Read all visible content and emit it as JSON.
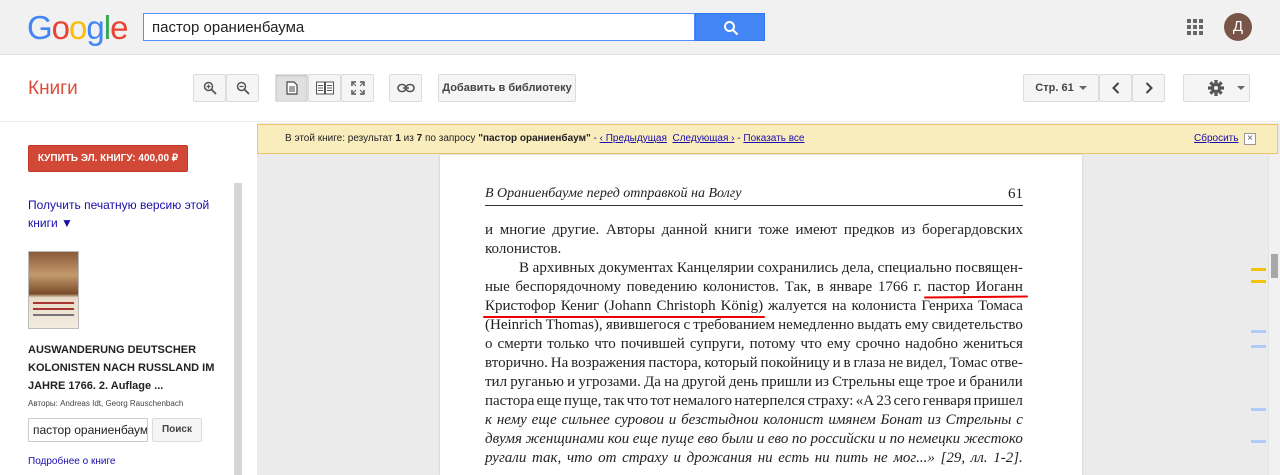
{
  "google": {
    "logo_letters": [
      {
        "ch": "G",
        "color": "#4285f4"
      },
      {
        "ch": "o",
        "color": "#ea4335"
      },
      {
        "ch": "o",
        "color": "#fbbc05"
      },
      {
        "ch": "g",
        "color": "#4285f4"
      },
      {
        "ch": "l",
        "color": "#34a853"
      },
      {
        "ch": "e",
        "color": "#ea4335"
      }
    ],
    "search_value": "пастор ораниенбаума",
    "avatar_letter": "Д"
  },
  "toolbar": {
    "title": "Книги",
    "add_library_label": "Добавить в библиотеку",
    "page_select_label": "Стр. 61",
    "icons": [
      "zoom-in-icon",
      "zoom-out-icon",
      "single-page-icon",
      "two-page-icon",
      "fullscreen-icon",
      "link-icon",
      "chevron-left-icon",
      "chevron-right-icon",
      "gear-icon"
    ]
  },
  "sidebar": {
    "buy_label": "КУПИТЬ ЭЛ. КНИГУ: 400,00 ₽",
    "print_label": "Получить печатную версию этой книги ▼",
    "book_title": "AUSWANDERUNG DEUTSCHER KOLONISTEN NACH RUSSLAND IM JAHRE 1766. 2. Auflage ...",
    "authors": "Авторы: Andreas Idt, Georg Rauschenbach",
    "inbook_value": "пастор ораниенбаума",
    "inbook_button": "Поиск",
    "more_link": "Подробнее о книге"
  },
  "notice": {
    "prefix": "В этой книге: результат ",
    "current": "1",
    "middle": " из ",
    "total": "7",
    "query_prefix": " по запросу ",
    "query": "\"пастор ораниенбаум\"",
    "sep1": " - ",
    "prev": "‹ Предыдущая",
    "next": "Следующая ›",
    "sep2": " - ",
    "show_all": "Показать все",
    "reset": "Сбросить",
    "close": "×"
  },
  "page": {
    "header": "В Ораниенбауме перед отправкой на Волгу",
    "number": "61",
    "lines": [
      {
        "text": "и многие другие. Авторы данной книги тоже имеют предков из борегардовских",
        "style": "justify"
      },
      {
        "text": "колонистов.",
        "style": "left"
      },
      {
        "text": "В архивных документах Канцелярии сохранились дела, специально посвящен-",
        "style": "indent"
      },
      {
        "text": "ные беспорядочному поведению колонистов. Так, в январе 1766 г. пастор Иоганн",
        "style": "justify"
      },
      {
        "text": "Кристофор Кениг (Johann Christoph König) жалуется на колониста Генриха Томаса",
        "style": "justify"
      },
      {
        "text": "(Heinrich Thomas), явившегося с требованием немедленно выдать ему свидетельство",
        "style": "justify"
      },
      {
        "text": "о смерти только что почившей супруги, потому что ему срочно надобно жениться",
        "style": "justify"
      },
      {
        "text": "вторично. На возражения пастора, который покойницу и в глаза не видел, Томас отве-",
        "style": "justify"
      },
      {
        "text": "тил руганью и угрозами. Да на другой день пришли из Стрельны еще трое и бранили",
        "style": "justify"
      },
      {
        "text": "пастора еще пуще, так что тот немалого натерпелся страху: «А 23 сего генваря пришел",
        "style": "justify"
      },
      {
        "text": "к нему еще сильнее суровои и безстыднои колонист имянем Бонат из Стрельны с",
        "style": "italic"
      },
      {
        "text": "двумя женщинами кои еще пуще ево были и ево по российски и по немецки жестоко",
        "style": "italic"
      },
      {
        "text": "ругали так, что от страху и дрожания ни есть ни пить не мог...» [29, лл. 1-2].",
        "style": "italic"
      }
    ]
  },
  "colors": {
    "accent_red": "#dd4b39",
    "buy_red": "#d14836",
    "link_blue": "#1a0dab",
    "search_blue": "#4285f4",
    "notice_bg": "#f9edbe",
    "underline_red": "#e00000"
  }
}
